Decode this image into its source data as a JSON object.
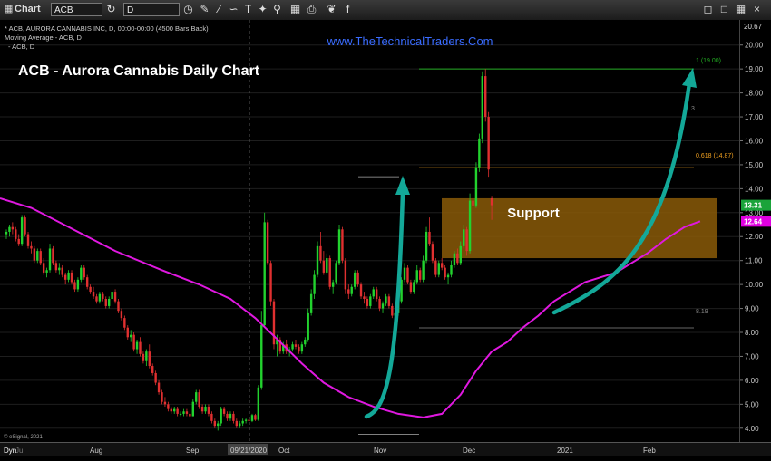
{
  "toolbar": {
    "app_label": "Chart",
    "symbol": "ACB",
    "interval": "D"
  },
  "header": {
    "info_line1": "* ACB, AURORA CANNABIS INC, D, 00:00-00:00 (4500 Bars Back)",
    "info_line2": "Moving Average - ACB, D",
    "info_line3": "- ACB, D",
    "watermark": "www.TheTechnicalTraders.Com",
    "title": "ACB - Aurora Cannabis Daily Chart",
    "credit": "© eSignal, 2021"
  },
  "annotations": {
    "support_label": "Support",
    "fib_1_label": "1 (19.00)",
    "fib_0618_label": "0.618 (14.87)",
    "fib_mid_label": "3",
    "low_label": "8.19",
    "top_price": "20.67"
  },
  "price_tags": [
    {
      "label": "13.31",
      "value": 13.31,
      "color": "#1aa33a"
    },
    {
      "label": "12.64",
      "value": 12.64,
      "color": "#e000e0"
    }
  ],
  "colors": {
    "up": "#22d22e",
    "down": "#e03030",
    "ma": "#e018e0",
    "arrow": "#13a898",
    "support_fill": "#8a5a08",
    "fib_green": "#22aa22",
    "fib_orange": "#f0a020",
    "watermark": "#3a6cff"
  },
  "chart_data": {
    "type": "candlestick",
    "symbol": "ACB",
    "interval": "Daily",
    "ylim": [
      3.5,
      20.67
    ],
    "yticks": [
      4,
      5,
      6,
      7,
      8,
      9,
      10,
      11,
      12,
      13,
      14,
      15,
      16,
      17,
      18,
      19,
      20
    ],
    "ytick_labels": [
      "4.00",
      "5.00",
      "6.00",
      "7.00",
      "8.00",
      "9.00",
      "10.00",
      "11.00",
      "12.00",
      "13.00",
      "14.00",
      "15.00",
      "16.00",
      "17.00",
      "18.00",
      "19.00",
      "20.00"
    ],
    "x_axis_labels": [
      "Dyn",
      "Jul",
      "Aug",
      "Sep",
      "09/21/2020",
      "Oct",
      "Nov",
      "Dec",
      "2021",
      "Feb"
    ],
    "support_zone": [
      11.1,
      13.6
    ],
    "fib_levels": [
      {
        "ratio": "1",
        "value": 19.0
      },
      {
        "ratio": "0.618",
        "value": 14.87
      }
    ],
    "marked_lows": [
      8.19,
      3.75
    ],
    "ohlc": [
      [
        12.1,
        12.3,
        11.9,
        12.2
      ],
      [
        12.2,
        12.5,
        12.0,
        12.4
      ],
      [
        12.4,
        12.6,
        12.1,
        12.3
      ],
      [
        12.3,
        12.4,
        11.8,
        11.9
      ],
      [
        11.9,
        12.1,
        11.6,
        11.7
      ],
      [
        11.7,
        12.9,
        11.6,
        12.8
      ],
      [
        12.8,
        12.9,
        12.0,
        12.1
      ],
      [
        12.1,
        12.2,
        11.5,
        11.6
      ],
      [
        11.6,
        11.8,
        11.3,
        11.5
      ],
      [
        11.5,
        11.6,
        10.9,
        11.0
      ],
      [
        11.0,
        11.5,
        10.9,
        11.4
      ],
      [
        11.4,
        11.5,
        10.8,
        10.9
      ],
      [
        10.9,
        11.1,
        10.4,
        10.5
      ],
      [
        10.5,
        10.7,
        10.3,
        10.6
      ],
      [
        10.6,
        11.7,
        10.5,
        11.5
      ],
      [
        11.5,
        11.6,
        10.8,
        10.9
      ],
      [
        10.9,
        11.0,
        10.5,
        10.6
      ],
      [
        10.6,
        10.9,
        10.4,
        10.7
      ],
      [
        10.7,
        10.8,
        10.3,
        10.4
      ],
      [
        10.4,
        10.5,
        10.0,
        10.2
      ],
      [
        10.2,
        10.6,
        10.1,
        10.5
      ],
      [
        10.5,
        10.6,
        10.0,
        10.1
      ],
      [
        10.1,
        10.2,
        9.7,
        9.8
      ],
      [
        9.8,
        10.3,
        9.7,
        10.2
      ],
      [
        10.2,
        10.8,
        10.1,
        10.7
      ],
      [
        10.7,
        10.8,
        10.2,
        10.3
      ],
      [
        10.3,
        10.4,
        9.8,
        9.9
      ],
      [
        9.9,
        10.0,
        9.6,
        9.7
      ],
      [
        9.7,
        9.9,
        9.4,
        9.5
      ],
      [
        9.5,
        9.6,
        9.2,
        9.3
      ],
      [
        9.3,
        9.7,
        9.2,
        9.6
      ],
      [
        9.6,
        9.7,
        9.3,
        9.4
      ],
      [
        9.4,
        9.5,
        9.0,
        9.1
      ],
      [
        9.1,
        9.5,
        9.0,
        9.4
      ],
      [
        9.4,
        9.8,
        9.3,
        9.7
      ],
      [
        9.7,
        9.8,
        9.2,
        9.3
      ],
      [
        9.3,
        9.4,
        8.8,
        8.9
      ],
      [
        8.9,
        9.0,
        8.5,
        8.6
      ],
      [
        8.6,
        8.7,
        8.1,
        8.2
      ],
      [
        8.2,
        8.3,
        7.7,
        7.8
      ],
      [
        7.8,
        8.1,
        7.6,
        7.9
      ],
      [
        7.9,
        8.0,
        7.2,
        7.3
      ],
      [
        7.3,
        7.7,
        7.1,
        7.6
      ],
      [
        7.6,
        7.8,
        7.0,
        7.1
      ],
      [
        7.1,
        7.2,
        6.7,
        6.8
      ],
      [
        6.8,
        7.3,
        6.6,
        7.2
      ],
      [
        7.2,
        7.5,
        6.5,
        6.6
      ],
      [
        6.6,
        6.7,
        6.2,
        6.3
      ],
      [
        6.3,
        6.4,
        5.8,
        5.9
      ],
      [
        5.9,
        6.0,
        5.4,
        5.5
      ],
      [
        5.5,
        5.6,
        5.0,
        5.1
      ],
      [
        5.1,
        5.3,
        4.9,
        5.0
      ],
      [
        5.0,
        5.1,
        4.7,
        4.8
      ],
      [
        4.8,
        4.9,
        4.6,
        4.7
      ],
      [
        4.7,
        4.9,
        4.6,
        4.8
      ],
      [
        4.8,
        4.9,
        4.5,
        4.6
      ],
      [
        4.6,
        4.7,
        4.5,
        4.6
      ],
      [
        4.6,
        4.8,
        4.5,
        4.7
      ],
      [
        4.7,
        4.8,
        4.5,
        4.6
      ],
      [
        4.6,
        4.7,
        4.4,
        4.5
      ],
      [
        4.5,
        5.2,
        4.5,
        5.1
      ],
      [
        5.1,
        5.6,
        5.0,
        5.5
      ],
      [
        5.5,
        5.6,
        4.8,
        4.9
      ],
      [
        4.9,
        5.0,
        4.6,
        4.7
      ],
      [
        4.7,
        5.0,
        4.6,
        4.9
      ],
      [
        4.9,
        5.0,
        4.5,
        4.6
      ],
      [
        4.6,
        4.7,
        4.2,
        4.3
      ],
      [
        4.3,
        4.4,
        4.0,
        4.1
      ],
      [
        4.1,
        4.3,
        3.9,
        4.2
      ],
      [
        4.2,
        4.9,
        4.1,
        4.8
      ],
      [
        4.8,
        4.9,
        4.5,
        4.6
      ],
      [
        4.6,
        4.7,
        4.3,
        4.4
      ],
      [
        4.4,
        4.7,
        4.3,
        4.6
      ],
      [
        4.6,
        4.7,
        4.2,
        4.3
      ],
      [
        4.3,
        4.4,
        4.0,
        4.1
      ],
      [
        4.1,
        4.3,
        4.0,
        4.2
      ],
      [
        4.2,
        4.4,
        4.1,
        4.3
      ],
      [
        4.3,
        4.4,
        4.2,
        4.35
      ],
      [
        4.35,
        4.4,
        4.2,
        4.3
      ],
      [
        4.3,
        4.6,
        4.25,
        4.55
      ],
      [
        4.55,
        4.6,
        4.3,
        4.35
      ],
      [
        4.35,
        5.8,
        4.3,
        5.7
      ],
      [
        5.7,
        8.9,
        5.6,
        8.3
      ],
      [
        8.3,
        13.0,
        8.2,
        12.6
      ],
      [
        12.6,
        12.7,
        10.8,
        10.9
      ],
      [
        10.9,
        11.0,
        9.1,
        9.3
      ],
      [
        9.3,
        9.4,
        7.3,
        7.5
      ],
      [
        7.5,
        7.9,
        7.0,
        7.7
      ],
      [
        7.7,
        7.8,
        7.1,
        7.2
      ],
      [
        7.2,
        7.6,
        7.1,
        7.5
      ],
      [
        7.5,
        7.7,
        7.1,
        7.2
      ],
      [
        7.2,
        7.4,
        7.0,
        7.3
      ],
      [
        7.3,
        7.6,
        7.2,
        7.5
      ],
      [
        7.5,
        7.7,
        7.3,
        7.4
      ],
      [
        7.4,
        7.5,
        7.1,
        7.2
      ],
      [
        7.2,
        7.6,
        7.1,
        7.5
      ],
      [
        7.5,
        7.8,
        7.4,
        7.7
      ],
      [
        7.7,
        9.0,
        7.6,
        8.8
      ],
      [
        8.8,
        9.8,
        8.7,
        9.6
      ],
      [
        9.6,
        10.6,
        9.4,
        10.4
      ],
      [
        10.4,
        11.8,
        10.3,
        11.6
      ],
      [
        11.6,
        12.2,
        10.9,
        11.0
      ],
      [
        11.0,
        11.4,
        10.4,
        10.5
      ],
      [
        10.5,
        11.3,
        10.4,
        11.1
      ],
      [
        11.1,
        11.2,
        9.8,
        9.9
      ],
      [
        9.9,
        10.2,
        9.6,
        10.1
      ],
      [
        10.1,
        11.0,
        10.0,
        10.9
      ],
      [
        10.9,
        12.5,
        10.8,
        12.3
      ],
      [
        12.3,
        12.4,
        10.9,
        11.0
      ],
      [
        11.0,
        11.1,
        9.6,
        9.8
      ],
      [
        9.8,
        10.0,
        9.4,
        9.6
      ],
      [
        9.6,
        10.0,
        9.5,
        9.9
      ],
      [
        9.9,
        10.6,
        9.8,
        10.5
      ],
      [
        10.5,
        10.6,
        9.9,
        10.0
      ],
      [
        10.0,
        10.1,
        9.4,
        9.5
      ],
      [
        9.5,
        9.7,
        9.2,
        9.4
      ],
      [
        9.4,
        9.5,
        9.0,
        9.1
      ],
      [
        9.1,
        9.6,
        9.0,
        9.5
      ],
      [
        9.5,
        9.9,
        9.4,
        9.8
      ],
      [
        9.8,
        9.9,
        9.3,
        9.4
      ],
      [
        9.4,
        9.5,
        8.9,
        9.0
      ],
      [
        9.0,
        9.3,
        8.8,
        9.2
      ],
      [
        9.2,
        9.6,
        9.1,
        9.5
      ],
      [
        9.5,
        9.6,
        9.0,
        9.1
      ],
      [
        9.1,
        9.2,
        8.6,
        8.7
      ],
      [
        8.7,
        8.9,
        8.4,
        8.8
      ],
      [
        8.8,
        9.4,
        8.7,
        9.3
      ],
      [
        9.3,
        10.3,
        9.2,
        10.2
      ],
      [
        10.2,
        10.9,
        10.1,
        10.7
      ],
      [
        10.7,
        10.8,
        10.0,
        10.1
      ],
      [
        10.1,
        10.2,
        9.6,
        9.7
      ],
      [
        9.7,
        10.2,
        9.6,
        10.1
      ],
      [
        10.1,
        10.8,
        10.0,
        10.6
      ],
      [
        10.6,
        10.7,
        10.1,
        10.2
      ],
      [
        10.2,
        11.2,
        10.1,
        11.0
      ],
      [
        11.0,
        12.4,
        10.9,
        12.2
      ],
      [
        12.2,
        12.8,
        11.6,
        11.7
      ],
      [
        11.7,
        11.8,
        10.9,
        11.0
      ],
      [
        11.0,
        11.1,
        10.3,
        10.4
      ],
      [
        10.4,
        11.0,
        10.3,
        10.9
      ],
      [
        10.9,
        11.1,
        10.6,
        10.7
      ],
      [
        10.7,
        10.8,
        10.2,
        10.3
      ],
      [
        10.3,
        10.5,
        10.0,
        10.4
      ],
      [
        10.4,
        11.0,
        10.3,
        10.8
      ],
      [
        10.8,
        11.4,
        10.7,
        11.3
      ],
      [
        11.3,
        11.5,
        10.8,
        10.9
      ],
      [
        10.9,
        11.8,
        10.8,
        11.6
      ],
      [
        11.6,
        12.5,
        11.5,
        12.3
      ],
      [
        12.3,
        12.4,
        11.2,
        11.4
      ],
      [
        11.4,
        13.8,
        11.3,
        13.5
      ],
      [
        13.5,
        14.2,
        13.0,
        13.3
      ],
      [
        13.3,
        15.1,
        13.2,
        14.9
      ],
      [
        14.9,
        16.3,
        14.7,
        16.1
      ],
      [
        16.1,
        18.9,
        15.9,
        18.7
      ],
      [
        18.7,
        19.0,
        16.8,
        17.0
      ],
      [
        17.0,
        17.2,
        14.5,
        14.8
      ],
      [
        13.6,
        13.7,
        12.7,
        13.31
      ]
    ],
    "moving_average": [
      [
        0,
        13.6
      ],
      [
        8,
        13.2
      ],
      [
        20,
        12.4
      ],
      [
        35,
        11.4
      ],
      [
        50,
        10.6
      ],
      [
        62,
        10.0
      ],
      [
        72,
        9.4
      ],
      [
        80,
        8.6
      ],
      [
        88,
        7.6
      ],
      [
        95,
        6.7
      ],
      [
        102,
        5.9
      ],
      [
        110,
        5.3
      ],
      [
        118,
        4.9
      ],
      [
        126,
        4.6
      ],
      [
        134,
        4.45
      ],
      [
        140,
        4.6
      ],
      [
        146,
        5.4
      ],
      [
        151,
        6.4
      ],
      [
        156,
        7.2
      ],
      [
        161,
        7.6
      ],
      [
        166,
        8.2
      ],
      [
        171,
        8.7
      ],
      [
        176,
        9.3
      ],
      [
        181,
        9.7
      ],
      [
        186,
        10.1
      ],
      [
        191,
        10.3
      ],
      [
        196,
        10.5
      ],
      [
        201,
        10.9
      ],
      [
        206,
        11.3
      ],
      [
        212,
        11.9
      ],
      [
        218,
        12.4
      ],
      [
        223,
        12.64
      ]
    ]
  }
}
